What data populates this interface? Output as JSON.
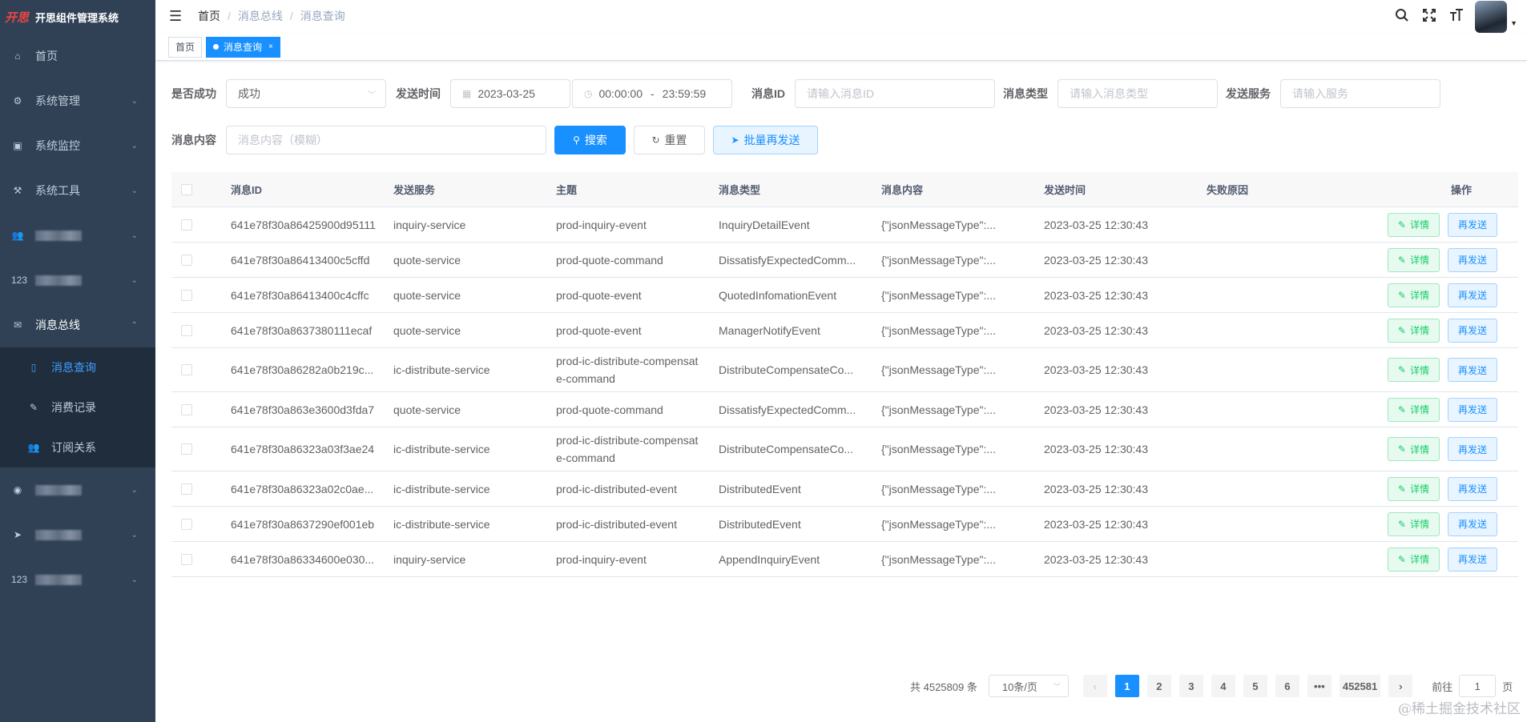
{
  "app": {
    "logo_mark": "开思",
    "title": "开思组件管理系统"
  },
  "sidebar": {
    "items": [
      {
        "icon": "⌂",
        "label": "首页",
        "arrow": ""
      },
      {
        "icon": "⚙",
        "label": "系统管理",
        "arrow": "⌄"
      },
      {
        "icon": "▣",
        "label": "系统监控",
        "arrow": "⌄"
      },
      {
        "icon": "⚒",
        "label": "系统工具",
        "arrow": "⌄"
      }
    ],
    "blurred_items": [
      {
        "icon": "👥",
        "arrow": "⌄"
      },
      {
        "icon": "123",
        "arrow": "⌄"
      }
    ],
    "open_group": {
      "icon": "✉",
      "label": "消息总线",
      "arrow": "⌃"
    },
    "sub_items": [
      {
        "icon": "▯",
        "label": "消息查询"
      },
      {
        "icon": "✎",
        "label": "消费记录"
      },
      {
        "icon": "👥",
        "label": "订阅关系"
      }
    ],
    "blurred_items_2": [
      {
        "icon": "◉",
        "arrow": "⌄"
      },
      {
        "icon": "➤",
        "arrow": "⌄"
      },
      {
        "icon": "123",
        "arrow": "⌄"
      }
    ]
  },
  "breadcrumb": {
    "home": "首页",
    "sep": "/",
    "level1": "消息总线",
    "level2": "消息查询"
  },
  "tags": {
    "home": "首页",
    "active": "消息查询",
    "close": "×"
  },
  "filters": {
    "success_label": "是否成功",
    "success_value": "成功",
    "time_label": "发送时间",
    "date_value": "2023-03-25",
    "time_start": "00:00:00",
    "time_sep": "-",
    "time_end": "23:59:59",
    "msgid_label": "消息ID",
    "msgid_placeholder": "请输入消息ID",
    "type_label": "消息类型",
    "type_placeholder": "请输入消息类型",
    "service_label": "发送服务",
    "service_placeholder": "请输入服务",
    "content_label": "消息内容",
    "content_placeholder": "消息内容（模糊）",
    "search_btn": "搜索",
    "reset_btn": "重置",
    "batch_btn": "批量再发送"
  },
  "table": {
    "headers": {
      "id": "消息ID",
      "service": "发送服务",
      "topic": "主题",
      "type": "消息类型",
      "content": "消息内容",
      "time": "发送时间",
      "reason": "失败原因",
      "op": "操作"
    },
    "detail_label": "详情",
    "resend_label": "再发送",
    "rows": [
      {
        "id": "641e78f30a86425900d95111",
        "service": "inquiry-service",
        "topic": "prod-inquiry-event",
        "type": "InquiryDetailEvent",
        "content": "{\"jsonMessageType\":...",
        "time": "2023-03-25 12:30:43",
        "reason": ""
      },
      {
        "id": "641e78f30a86413400c5cffd",
        "service": "quote-service",
        "topic": "prod-quote-command",
        "type": "DissatisfyExpectedComm...",
        "content": "{\"jsonMessageType\":...",
        "time": "2023-03-25 12:30:43",
        "reason": ""
      },
      {
        "id": "641e78f30a86413400c4cffc",
        "service": "quote-service",
        "topic": "prod-quote-event",
        "type": "QuotedInfomationEvent",
        "content": "{\"jsonMessageType\":...",
        "time": "2023-03-25 12:30:43",
        "reason": ""
      },
      {
        "id": "641e78f30a8637380111ecaf",
        "service": "quote-service",
        "topic": "prod-quote-event",
        "type": "ManagerNotifyEvent",
        "content": "{\"jsonMessageType\":...",
        "time": "2023-03-25 12:30:43",
        "reason": ""
      },
      {
        "id": "641e78f30a86282a0b219c...",
        "service": "ic-distribute-service",
        "topic": "prod-ic-distribute-compensate-command",
        "type": "DistributeCompensateCo...",
        "content": "{\"jsonMessageType\":...",
        "time": "2023-03-25 12:30:43",
        "reason": ""
      },
      {
        "id": "641e78f30a863e3600d3fda7",
        "service": "quote-service",
        "topic": "prod-quote-command",
        "type": "DissatisfyExpectedComm...",
        "content": "{\"jsonMessageType\":...",
        "time": "2023-03-25 12:30:43",
        "reason": ""
      },
      {
        "id": "641e78f30a86323a03f3ae24",
        "service": "ic-distribute-service",
        "topic": "prod-ic-distribute-compensate-command",
        "type": "DistributeCompensateCo...",
        "content": "{\"jsonMessageType\":...",
        "time": "2023-03-25 12:30:43",
        "reason": ""
      },
      {
        "id": "641e78f30a86323a02c0ae...",
        "service": "ic-distribute-service",
        "topic": "prod-ic-distributed-event",
        "type": "DistributedEvent",
        "content": "{\"jsonMessageType\":...",
        "time": "2023-03-25 12:30:43",
        "reason": ""
      },
      {
        "id": "641e78f30a8637290ef001eb",
        "service": "ic-distribute-service",
        "topic": "prod-ic-distributed-event",
        "type": "DistributedEvent",
        "content": "{\"jsonMessageType\":...",
        "time": "2023-03-25 12:30:43",
        "reason": ""
      },
      {
        "id": "641e78f30a86334600e030...",
        "service": "inquiry-service",
        "topic": "prod-inquiry-event",
        "type": "AppendInquiryEvent",
        "content": "{\"jsonMessageType\":...",
        "time": "2023-03-25 12:30:43",
        "reason": ""
      }
    ]
  },
  "pagination": {
    "total_text": "共 4525809 条",
    "page_size": "10条/页",
    "prev": "‹",
    "pages": [
      "1",
      "2",
      "3",
      "4",
      "5",
      "6"
    ],
    "active_page": "1",
    "ellipsis": "•••",
    "last": "452581",
    "next": "›",
    "goto_prefix": "前往",
    "goto_value": "1",
    "goto_suffix": "页"
  },
  "watermark": "@稀土掘金技术社区",
  "colors": {
    "sidebar_bg": "#304156",
    "submenu_bg": "#1f2d3d",
    "primary": "#1890ff",
    "success": "#13ce66"
  }
}
